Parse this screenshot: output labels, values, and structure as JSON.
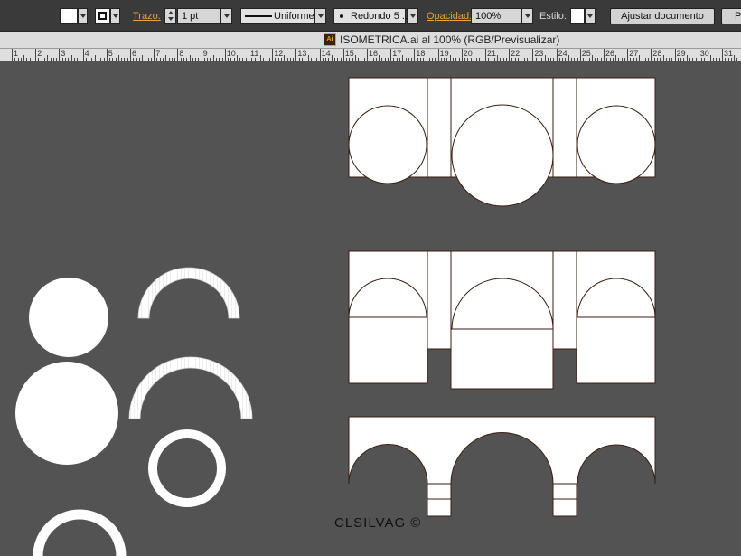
{
  "toolbar": {
    "stroke_label": "Trazo:",
    "stroke_weight": "1 pt",
    "stroke_profile": "Uniforme",
    "brush": "Redondo 5 ...",
    "opacity_label": "Opacidad:",
    "opacity_value": "100%",
    "style_label": "Estilo:",
    "adjust_document_button": "Ajustar documento",
    "preferences_button": "Pr"
  },
  "document": {
    "icon_text": "Ai",
    "title": "ISOMETRICA.ai al 100% (RGB/Previsualizar)"
  },
  "ruler": {
    "numbers": [
      "1",
      "2",
      "3",
      "4",
      "5",
      "6",
      "7",
      "8",
      "9",
      "10",
      "11",
      "12",
      "13",
      "14",
      "15",
      "16",
      "17",
      "18",
      "19",
      "20",
      "21",
      "22",
      "23",
      "24",
      "25",
      "26",
      "27",
      "28",
      "29",
      "30",
      "31"
    ]
  },
  "canvas": {
    "signature": "CLSILVAG ©"
  },
  "colors": {
    "canvas_bg": "#535353",
    "artwork_fill": "#ffffff",
    "artwork_stroke": "#3a1e10",
    "accent_label": "#e8a33a"
  }
}
